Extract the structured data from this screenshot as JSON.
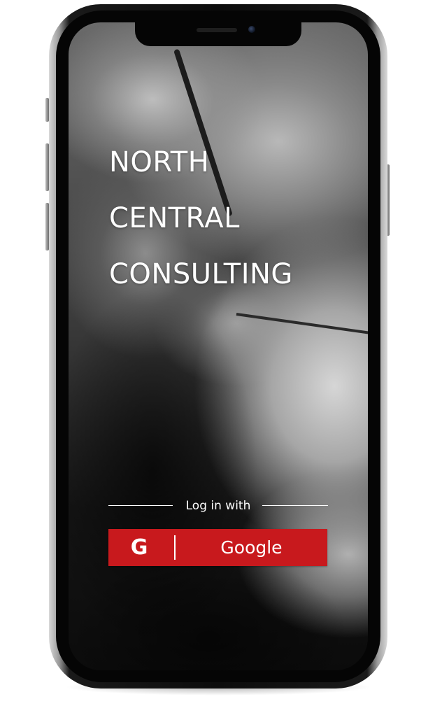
{
  "app": {
    "title_lines": [
      "NORTH",
      "CENTRAL",
      "CONSULTING"
    ]
  },
  "login": {
    "prompt": "Log in with",
    "provider_button": {
      "icon": "G",
      "icon_name": "google-g-icon",
      "label": "Google",
      "background_color": "#c8191d",
      "text_color": "#ffffff"
    }
  },
  "theme": {
    "accent": "#c8191d",
    "text": "#ffffff"
  }
}
